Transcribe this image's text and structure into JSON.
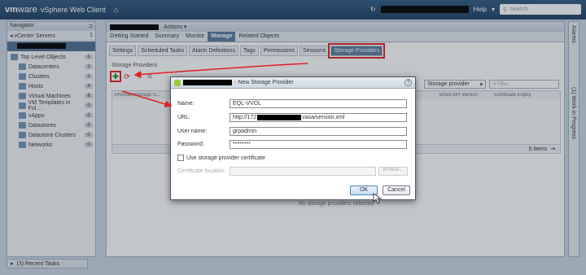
{
  "header": {
    "brand_vm": "vm",
    "brand_ware": "ware",
    "app_title": "vSphere Web Client",
    "home_icon": "home-icon",
    "help_label": "Help",
    "search_placeholder": "Search"
  },
  "navigator": {
    "title": "Navigator",
    "breadcrumb": "vCenter Servers",
    "breadcrumb_count": "1",
    "items": [
      {
        "label": "Top Level Objects",
        "count": "1"
      },
      {
        "label": "Datacenters",
        "count": "1"
      },
      {
        "label": "Clusters",
        "count": "1"
      },
      {
        "label": "Hosts",
        "count": "4"
      },
      {
        "label": "Virtual Machines",
        "count": "6"
      },
      {
        "label": "VM Templates in Fol...",
        "count": "0"
      },
      {
        "label": "vApps",
        "count": "0"
      },
      {
        "label": "Datastores",
        "count": "0"
      },
      {
        "label": "Datastore Clusters",
        "count": "0"
      },
      {
        "label": "Networks",
        "count": "0"
      }
    ]
  },
  "main": {
    "actions_label": "Actions",
    "tabs": [
      "Getting Started",
      "Summary",
      "Monitor",
      "Manage",
      "Related Objects"
    ],
    "active_tab": "Manage",
    "subtabs": [
      "Settings",
      "Scheduled Tasks",
      "Alarm Definitions",
      "Tags",
      "Permissions",
      "Sessions",
      "Storage Providers"
    ],
    "active_subtab": "Storage Providers",
    "section_title": "Storage Providers",
    "grid_columns": [
      "Provider/Storage S...",
      "Last Rescan Time",
      "VASA API Version",
      "Certificate Expiry"
    ],
    "filter_select": "Storage provider",
    "filter_placeholder": "Filter",
    "items_count": "0 items",
    "empty_message": "No storage providers selected"
  },
  "rail": {
    "alarms": "Alarms",
    "work": "(1) Work in Progress"
  },
  "bottom": {
    "recent_tasks": "(3)  Recent Tasks"
  },
  "dialog": {
    "title_suffix": "- New Storage Provider",
    "name_label": "Name:",
    "name_value": "EQL-VVOL",
    "url_label": "URL:",
    "url_prefix": "http://172",
    "url_suffix": "vasa/version.xml",
    "user_label": "User name:",
    "user_value": "grpadmin",
    "password_label": "Password:",
    "password_value": "********",
    "cert_checkbox_label": "Use storage provider certificate",
    "cert_location_label": "Certificate location:",
    "browse_label": "Browse...",
    "ok_label": "OK",
    "cancel_label": "Cancel"
  },
  "colors": {
    "header_bg": "#1e3f62",
    "active_tab": "#5b7a9c",
    "highlight": "#e02020",
    "add_icon": "#2a8b2a"
  }
}
